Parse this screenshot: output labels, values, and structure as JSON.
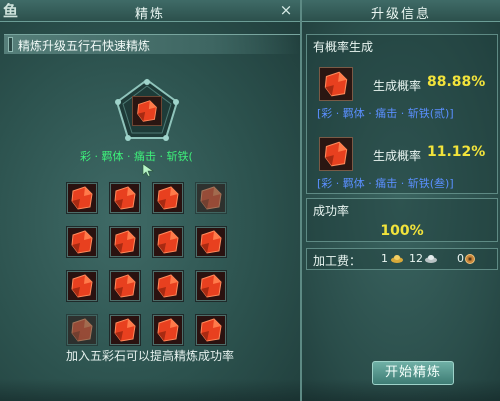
{
  "left_window": {
    "title": "精炼",
    "logo": "鱼",
    "close": "×",
    "tab_label": "精炼升级五行石快速精炼",
    "attribute_line": "彩 · 羁体 · 痛击 · 斩铁(",
    "hint": "加入五彩石可以提高精炼成功率",
    "grid_cells": [
      {
        "state": "filled"
      },
      {
        "state": "filled"
      },
      {
        "state": "filled"
      },
      {
        "state": "dim"
      },
      {
        "state": "filled"
      },
      {
        "state": "filled"
      },
      {
        "state": "filled"
      },
      {
        "state": "filled"
      },
      {
        "state": "filled"
      },
      {
        "state": "filled"
      },
      {
        "state": "filled"
      },
      {
        "state": "filled"
      },
      {
        "state": "dim"
      },
      {
        "state": "filled"
      },
      {
        "state": "filled"
      },
      {
        "state": "filled"
      }
    ]
  },
  "right_window": {
    "title": "升级信息",
    "probability_panel": {
      "title": "有概率生成",
      "results": [
        {
          "label": "生成概率",
          "rate": "88.88%",
          "attribute": "[彩 · 羁体 · 痛击 · 斩铁(贰)]"
        },
        {
          "label": "生成概率",
          "rate": "11.12%",
          "attribute": "[彩 · 羁体 · 痛击 · 斩铁(叁)]"
        }
      ]
    },
    "success_panel": {
      "title": "成功率",
      "value": "100%"
    },
    "fee_panel": {
      "label": "加工费：",
      "gold": "1",
      "silver": "12",
      "copper": "0"
    },
    "start_button": "开始精炼"
  },
  "colors": {
    "stone": "#e8401f",
    "attribute_green": "#3ef07a",
    "attribute_blue": "#5a8fff",
    "rate_yellow": "#f2e33b"
  }
}
